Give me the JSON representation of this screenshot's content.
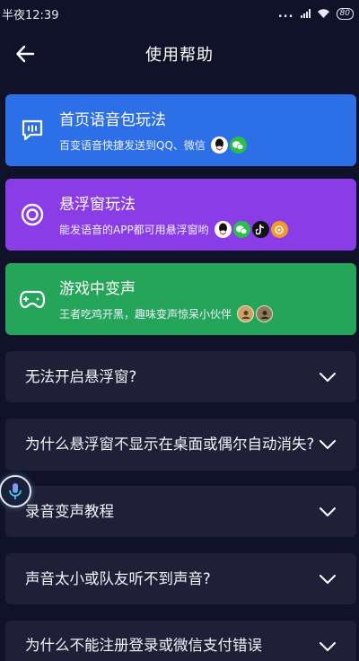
{
  "status_bar": {
    "time": "半夜12:39",
    "dots": "...",
    "battery": "80"
  },
  "header": {
    "title": "使用帮助"
  },
  "cards": [
    {
      "title": "首页语音包玩法",
      "subtitle": "百变语音快捷发送到QQ、微信",
      "color": "#2d6fe6",
      "icons": [
        "qq-icon",
        "wechat-icon"
      ]
    },
    {
      "title": "悬浮窗玩法",
      "subtitle": "能发语音的APP都可用悬浮窗哟",
      "color": "#8a3de6",
      "icons": [
        "qq-icon",
        "wechat-icon",
        "tiktok-icon",
        "app-icon"
      ]
    },
    {
      "title": "游戏中变声",
      "subtitle": "王者吃鸡开黑，趣味变声惊呆小伙伴",
      "color": "#25a55a",
      "icons": [
        "game-avatar-icon",
        "game-avatar-icon"
      ]
    }
  ],
  "faqs": [
    {
      "question": "无法开启悬浮窗?"
    },
    {
      "question": "为什么悬浮窗不显示在桌面或偶尔自动消失?"
    },
    {
      "question": "录音变声教程"
    },
    {
      "question": "声音太小或队友听不到声音?"
    },
    {
      "question": "为什么不能注册登录或微信支付错误"
    }
  ],
  "colors": {
    "background": "#10122a",
    "faq_background": "#1f2038"
  }
}
